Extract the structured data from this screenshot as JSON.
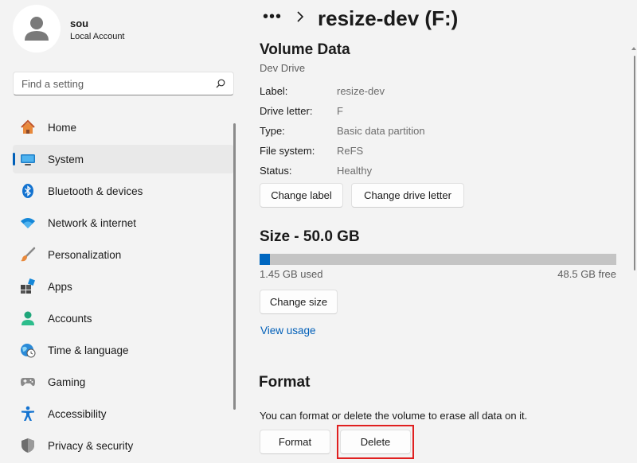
{
  "user": {
    "name": "sou",
    "account_type": "Local Account"
  },
  "search": {
    "placeholder": "Find a setting"
  },
  "nav": {
    "items": [
      {
        "label": "Home",
        "icon": "home-icon"
      },
      {
        "label": "System",
        "icon": "system-icon",
        "selected": true
      },
      {
        "label": "Bluetooth & devices",
        "icon": "bluetooth-icon"
      },
      {
        "label": "Network & internet",
        "icon": "wifi-icon"
      },
      {
        "label": "Personalization",
        "icon": "brush-icon"
      },
      {
        "label": "Apps",
        "icon": "apps-icon"
      },
      {
        "label": "Accounts",
        "icon": "person-icon"
      },
      {
        "label": "Time & language",
        "icon": "clock-globe-icon"
      },
      {
        "label": "Gaming",
        "icon": "gamepad-icon"
      },
      {
        "label": "Accessibility",
        "icon": "accessibility-icon"
      },
      {
        "label": "Privacy & security",
        "icon": "shield-icon"
      }
    ]
  },
  "breadcrumb": {
    "dots": "•••",
    "title": "resize-dev (F:)"
  },
  "volume": {
    "title": "Volume Data",
    "subtitle": "Dev Drive",
    "properties": [
      {
        "label": "Label:",
        "value": "resize-dev"
      },
      {
        "label": "Drive letter:",
        "value": "F"
      },
      {
        "label": "Type:",
        "value": "Basic data partition"
      },
      {
        "label": "File system:",
        "value": "ReFS"
      },
      {
        "label": "Status:",
        "value": "Healthy"
      }
    ],
    "change_label_button": "Change label",
    "change_drive_letter_button": "Change drive letter"
  },
  "size": {
    "title": "Size - 50.0 GB",
    "used_text": "1.45 GB used",
    "free_text": "48.5 GB free",
    "used_fraction": 0.029,
    "change_size_button": "Change size",
    "view_usage_link": "View usage"
  },
  "format": {
    "title": "Format",
    "description": "You can format or delete the volume to erase all data on it.",
    "format_button": "Format",
    "delete_button": "Delete"
  },
  "colors": {
    "accent": "#005fb8",
    "bar_fill": "#0067c0",
    "highlight": "#e02020"
  }
}
